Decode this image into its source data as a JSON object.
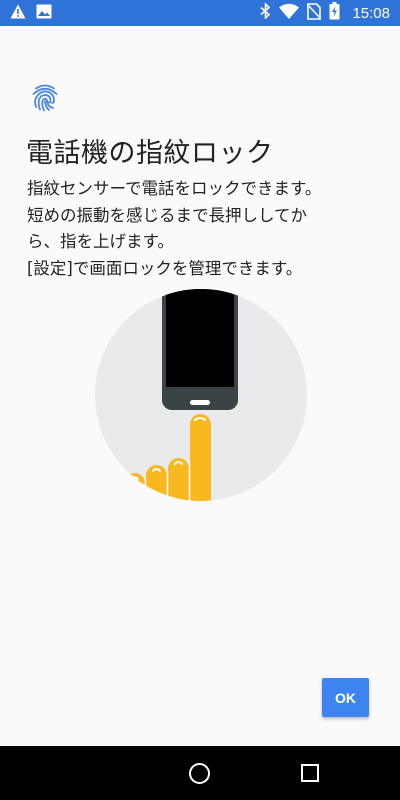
{
  "status_bar": {
    "time": "15:08",
    "background_color": "#2f72d8",
    "left_icons": [
      "warning-icon",
      "image-icon"
    ],
    "right_icons": [
      "bluetooth-icon",
      "wifi-icon",
      "no-sim-icon",
      "battery-charging-icon"
    ]
  },
  "content": {
    "icon": "fingerprint-icon",
    "title": "電話機の指紋ロック",
    "body_lines": [
      "指紋センサーで電話をロックできます。",
      "短めの振動を感じるまで長押ししてか",
      "ら、指を上げます。",
      "[設定]で画面ロックを管理できます。"
    ],
    "illustration": "finger-on-phone-sensor-illustration"
  },
  "actions": {
    "ok_label": "OK",
    "accent_color": "#3d84f0"
  },
  "nav_bar": {
    "icons": [
      "home-icon",
      "recents-icon"
    ]
  }
}
